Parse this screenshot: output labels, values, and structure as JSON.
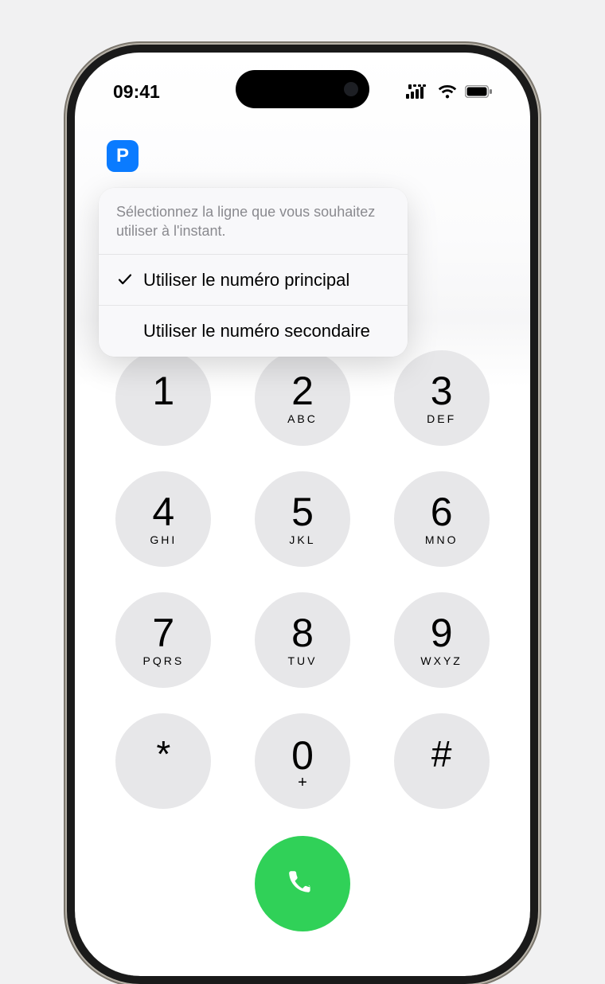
{
  "status": {
    "time": "09:41"
  },
  "line_badge": {
    "letter": "P"
  },
  "popover": {
    "prompt": "Sélectionnez la ligne que vous souhaitez utiliser à l'instant.",
    "items": [
      {
        "label": "Utiliser le numéro principal",
        "checked": true
      },
      {
        "label": "Utiliser le numéro secondaire",
        "checked": false
      }
    ]
  },
  "keypad": [
    {
      "digit": "1",
      "letters": ""
    },
    {
      "digit": "2",
      "letters": "ABC"
    },
    {
      "digit": "3",
      "letters": "DEF"
    },
    {
      "digit": "4",
      "letters": "GHI"
    },
    {
      "digit": "5",
      "letters": "JKL"
    },
    {
      "digit": "6",
      "letters": "MNO"
    },
    {
      "digit": "7",
      "letters": "PQRS"
    },
    {
      "digit": "8",
      "letters": "TUV"
    },
    {
      "digit": "9",
      "letters": "WXYZ"
    },
    {
      "digit": "*",
      "letters": "",
      "symbol": true
    },
    {
      "digit": "0",
      "letters": "+",
      "zero": true
    },
    {
      "digit": "#",
      "letters": "",
      "symbol": true
    }
  ],
  "colors": {
    "accent_blue": "#0a7bff",
    "call_green": "#30d158",
    "key_bg": "#e7e7e9"
  }
}
